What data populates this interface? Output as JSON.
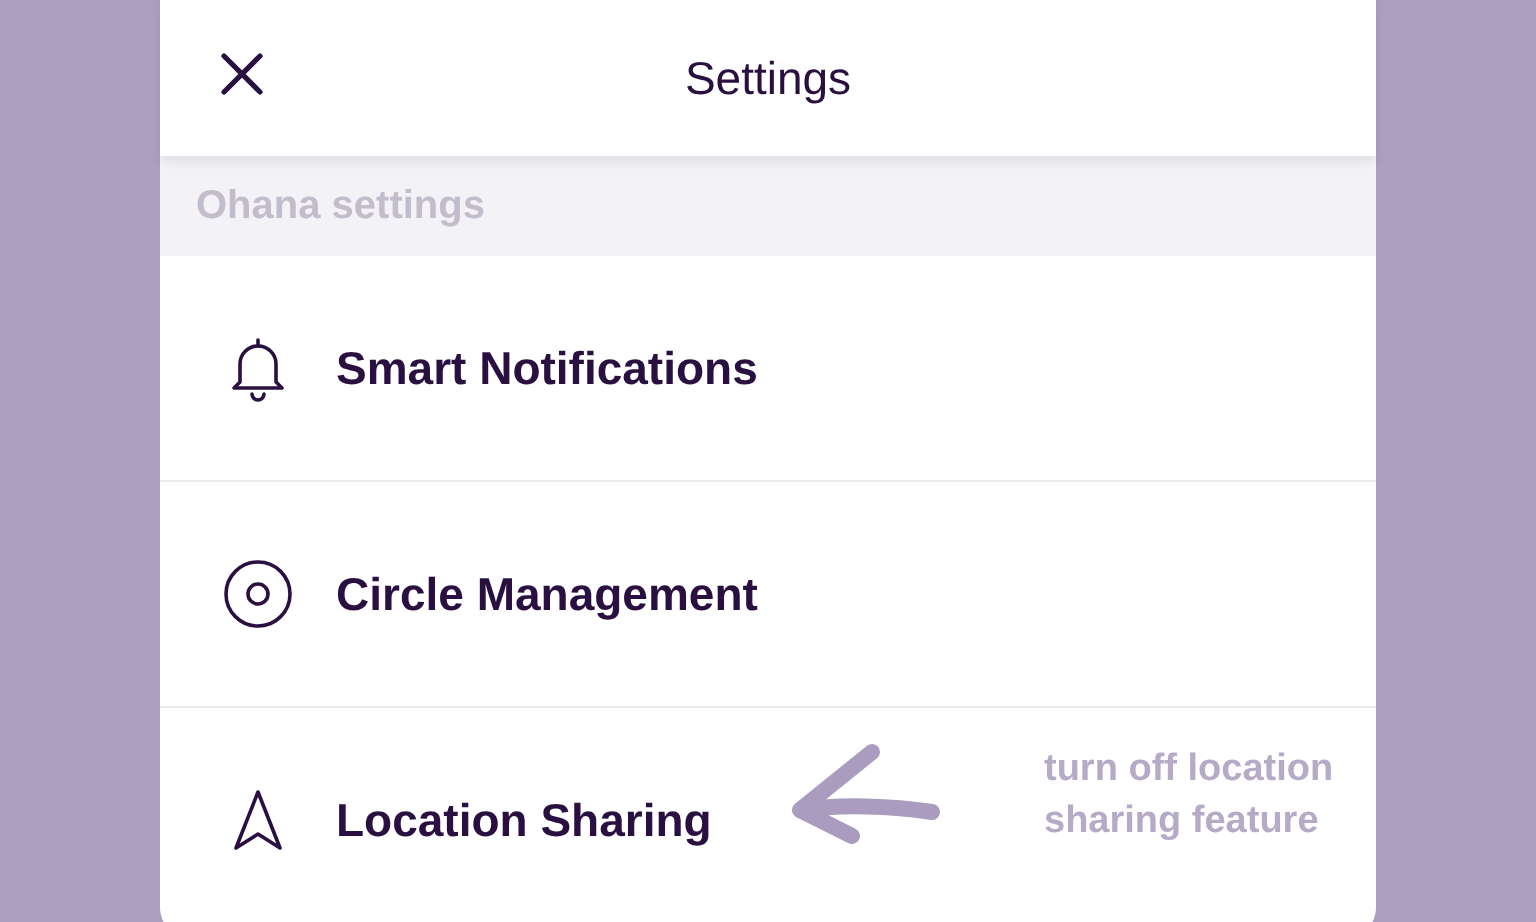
{
  "header": {
    "title": "Settings"
  },
  "section": {
    "title": "Ohana settings"
  },
  "items": [
    {
      "label": "Smart Notifications",
      "kind": "bell"
    },
    {
      "label": "Circle Management",
      "kind": "circle"
    },
    {
      "label": "Location Sharing",
      "kind": "navigation"
    }
  ],
  "annotation": {
    "text": "turn off location sharing feature"
  }
}
